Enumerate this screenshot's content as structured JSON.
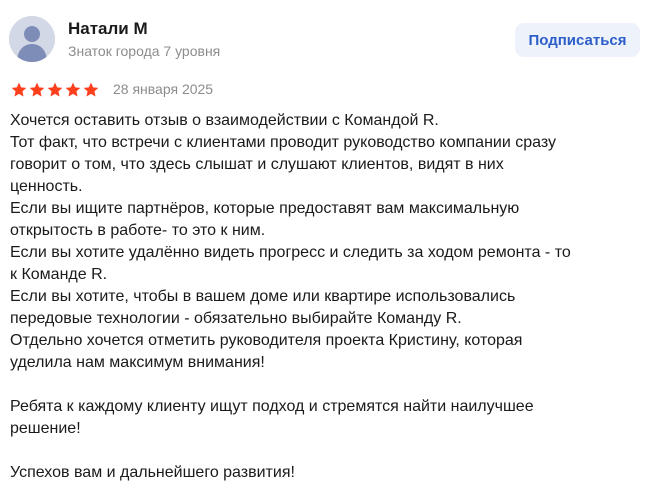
{
  "author": {
    "name": "Натали М",
    "level": "Знаток города 7 уровня"
  },
  "subscribe_label": "Подписаться",
  "rating": {
    "stars": 5,
    "max": 5,
    "star_color": "#fc3f1d"
  },
  "date": "28 января 2025",
  "text": {
    "l01": "Хочется оставить отзыв о взаимодействии с Командой R.",
    "l02": "Тот факт, что встречи с клиентами проводит руководство компании сразу",
    "l03": "говорит о том, что здесь слышат и слушают клиентов, видят в них",
    "l04": "ценность.",
    "l05": "Если вы ищите партнёров, которые предоставят вам максимальную",
    "l06": "открытость в работе- то это к ним.",
    "l07": "Если вы хотите удалённо видеть прогресс и следить за ходом ремонта - то",
    "l08": "к Команде R.",
    "l09": "Если вы хотите, чтобы в вашем доме или квартире использовались",
    "l10": "передовые технологии - обязательно выбирайте Команду R.",
    "l11": "Отдельно хочется отметить руководителя проекта Кристину, которая",
    "l12": "уделила нам максимум внимания!",
    "l13": "",
    "l14": "Ребята к каждому клиенту ищут подход и стремятся найти наилучшее",
    "l15": "решение!",
    "l16": "",
    "l17": "Успехов вам и дальнейшего развития!"
  }
}
